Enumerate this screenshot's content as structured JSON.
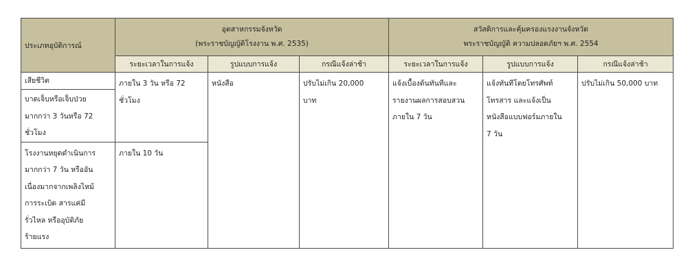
{
  "table": {
    "header": {
      "type_col": "ประเภทอุบัติการณ์",
      "group1": {
        "line1": "อุตสาหกรรมจังหวัด",
        "line2": "(พระราชบัญญัติโรงงาน พ.ศ. 2535)"
      },
      "group2": {
        "line1": "สวัสดิการและคุ้มครองแรงงานจังหวัด",
        "line2": "พระราชบัญญัติ ความปลอดภัยฯ พ.ศ. 2554"
      },
      "sub": [
        "ระยะเวลาในการแจ้ง",
        "รูปแบบการแจ้ง",
        "กรณีแจ้งล่าช้า",
        "ระยะเวลาในการแจ้ง",
        "รูปแบบการแจ้ง",
        "กรณีแจ้งล่าช้า"
      ]
    },
    "rows": {
      "death": "เสียชีวิต",
      "injury": [
        "บาดเจ็บหรือเจ็บป่วย",
        "มากกว่า 3 วันหรือ 72",
        "ชั่วโมง"
      ],
      "stop": [
        "โรงงานหยุดดำเนินการ",
        "มากกว่า 7 วัน หรืออัน",
        "เนื่องมากจากเพลิงไหม้",
        "การระเบิด สารแค่มี",
        "รั่วไหล หรืออุบัติภัย",
        "ร้ายแรง"
      ],
      "time1a": [
        "ภายใน 3 วัน หรือ 72",
        "ชั่วโมง"
      ],
      "time1b": "ภายใน 10 วัน",
      "form1": "หนังสือ",
      "late1": [
        "ปรับไม่เกิน 20,000",
        "บาท"
      ],
      "time2": [
        "แจ้งเบื้องต้นทันทีและ",
        "รายงานผลการสอบสวน",
        "ภายใน 7 วัน"
      ],
      "form2": [
        "แจ้งทันทีโดยโทรศัพท์",
        "โทรสาร และแจ้งเป็น",
        "หนังสือแบบฟอร์มภายใน",
        "7 วัน"
      ],
      "late2": "ปรับไม่เกิน 50,000 บาท"
    }
  }
}
